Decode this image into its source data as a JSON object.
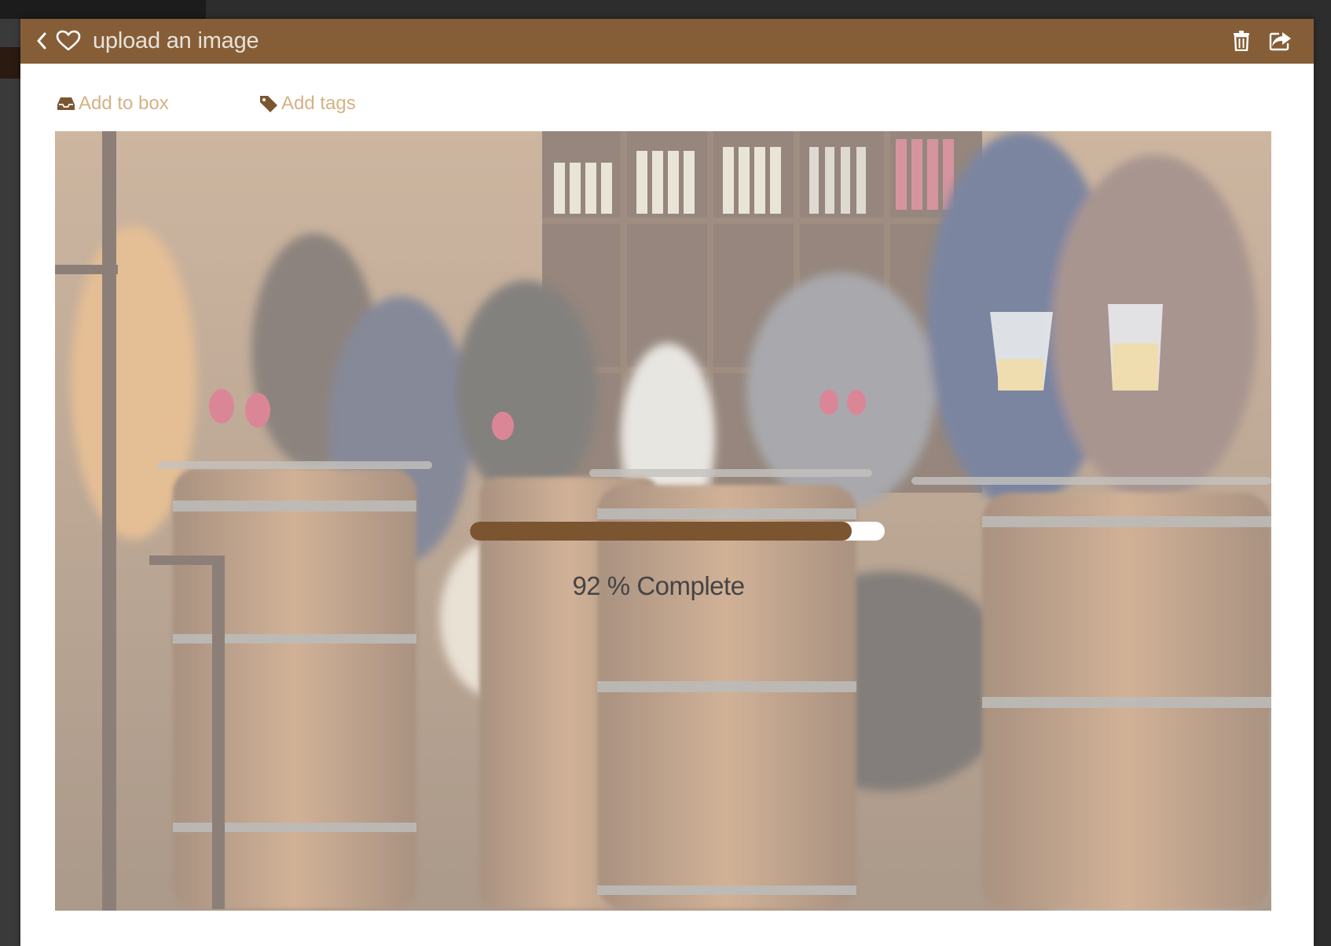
{
  "header": {
    "title": "upload an image",
    "back_icon": "chevron-left-icon",
    "favorite_icon": "heart-icon",
    "delete_icon": "trash-icon",
    "share_icon": "share-icon",
    "background_color": "#855e37"
  },
  "toolbar": {
    "add_to_box_label": "Add to box",
    "add_to_box_icon": "inbox-icon",
    "add_tags_label": "Add tags",
    "add_tags_icon": "tag-icon",
    "link_color": "#d6b185"
  },
  "upload": {
    "progress_percent": 92,
    "progress_label": "92 % Complete",
    "progress_fill_color": "#7a5530"
  }
}
